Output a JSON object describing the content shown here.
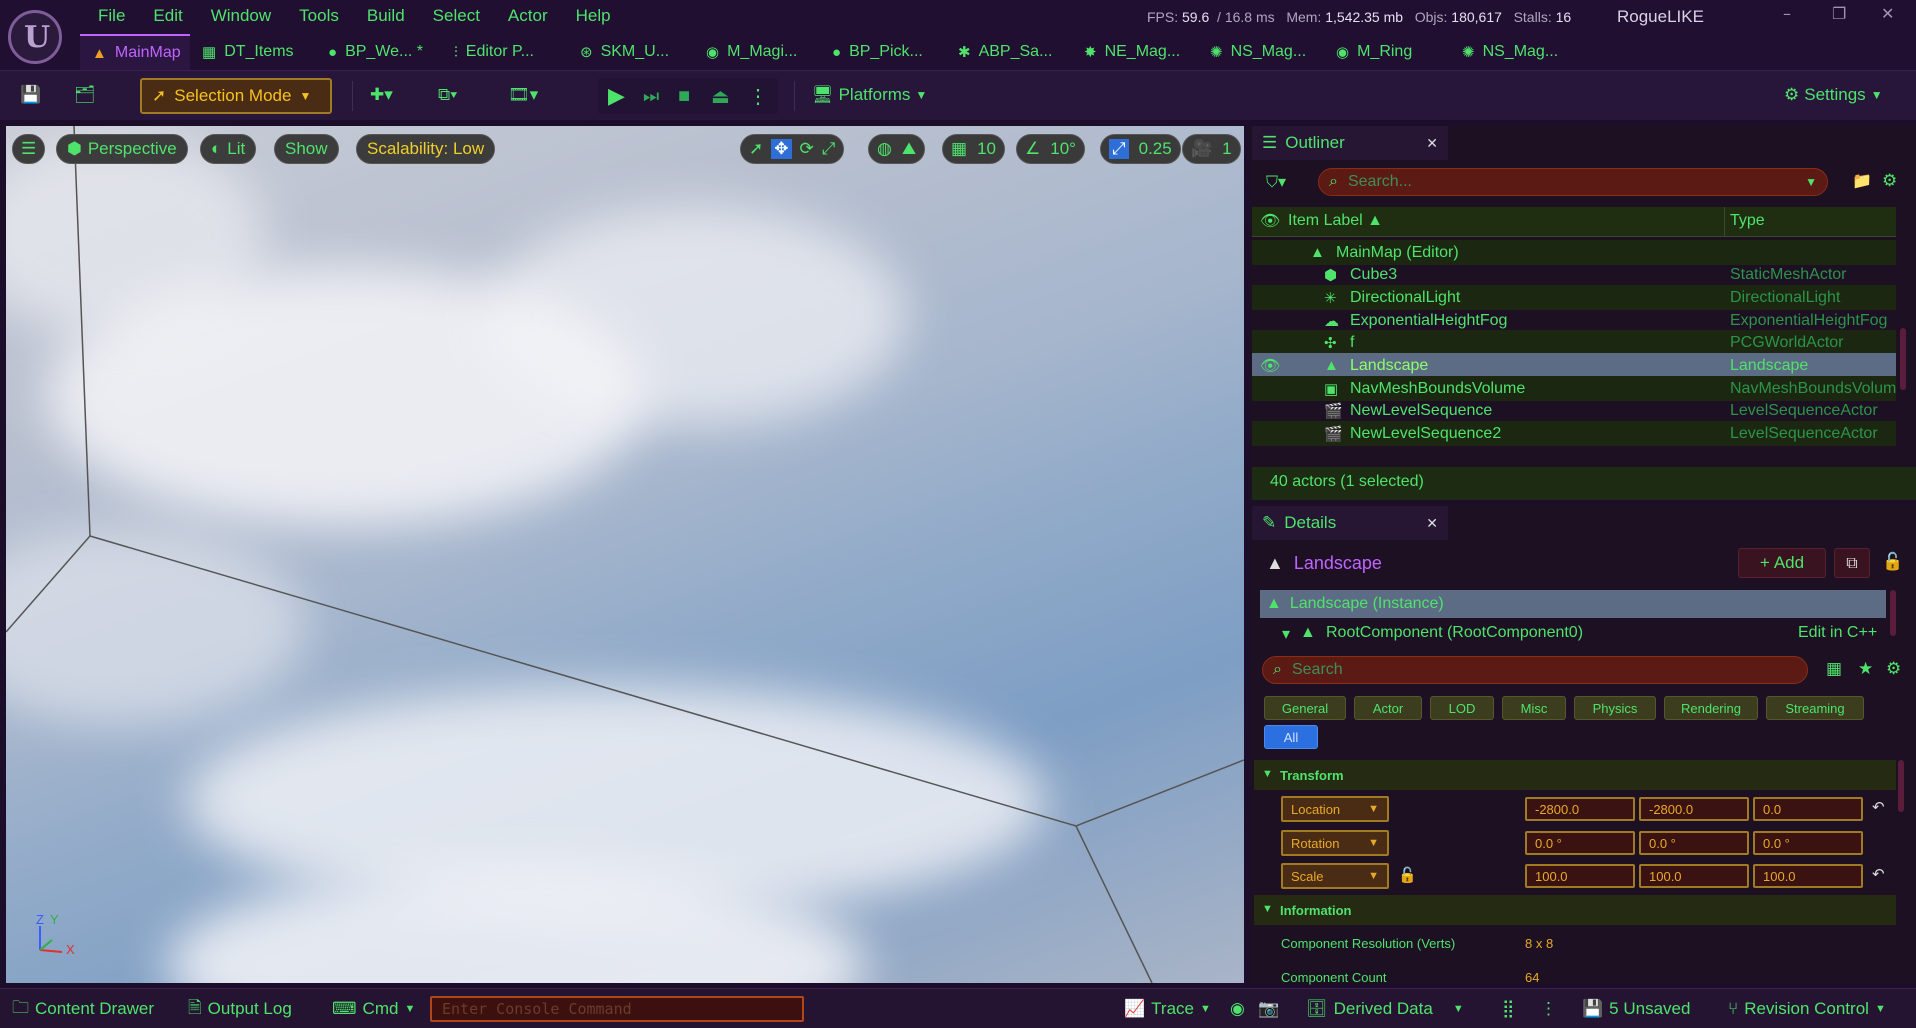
{
  "app": {
    "logo_letter": "U",
    "project_name": "RogueLIKE",
    "menu": [
      "File",
      "Edit",
      "Window",
      "Tools",
      "Build",
      "Select",
      "Actor",
      "Help"
    ],
    "stats": {
      "fps_label": "FPS:",
      "fps": "59.6",
      "ms": "/ 16.8 ms",
      "mem_label": "Mem:",
      "mem": "1,542.35 mb",
      "objs_label": "Objs:",
      "objs": "180,617",
      "stalls_label": "Stalls:",
      "stalls": "16"
    },
    "window_buttons": {
      "minimize": "–",
      "restore": "❐",
      "close": "✕"
    }
  },
  "tabs": [
    {
      "label": "MainMap",
      "icon": "level-icon",
      "glyph": "▲",
      "active": true
    },
    {
      "label": "DT_Items",
      "icon": "datatable-icon",
      "glyph": "▦"
    },
    {
      "label": "BP_We... *",
      "icon": "blueprint-icon",
      "glyph": "●"
    },
    {
      "label": "Editor P...",
      "icon": "settings-sliders-icon",
      "glyph": "⫶"
    },
    {
      "label": "SKM_U...",
      "icon": "skeletal-mesh-icon",
      "glyph": "⊛"
    },
    {
      "label": "M_Magi...",
      "icon": "material-icon",
      "glyph": "◉"
    },
    {
      "label": "BP_Pick...",
      "icon": "blueprint-icon",
      "glyph": "●"
    },
    {
      "label": "ABP_Sa...",
      "icon": "anim-blueprint-icon",
      "glyph": "✱"
    },
    {
      "label": "NE_Mag...",
      "icon": "niagara-emitter-icon",
      "glyph": "✸"
    },
    {
      "label": "NS_Mag...",
      "icon": "niagara-system-icon",
      "glyph": "✺"
    },
    {
      "label": "M_Ring",
      "icon": "material-icon",
      "glyph": "◉"
    },
    {
      "label": "NS_Mag...",
      "icon": "niagara-system-icon",
      "glyph": "✺"
    }
  ],
  "toolbar": {
    "selection_mode": "Selection Mode",
    "platforms": "Platforms",
    "settings": "Settings"
  },
  "viewport": {
    "menu_glyph": "☰",
    "perspective": "Perspective",
    "lit": "Lit",
    "show": "Show",
    "scalability": "Scalability: Low",
    "grid_snap": "10",
    "rotation_snap": "10°",
    "scale_snap": "0.25",
    "camera_speed": "1",
    "axis_z": "Z",
    "axis_y": "Y",
    "axis_x": "X"
  },
  "outliner": {
    "title": "Outliner",
    "search_placeholder": "Search...",
    "col_label": "Item Label ▲",
    "col_type": "Type",
    "rows": [
      {
        "label": "MainMap (Editor)",
        "type": "",
        "icon": "level-icon",
        "glyph": "▲",
        "indent": 0
      },
      {
        "label": "Cube3",
        "type": "StaticMeshActor",
        "icon": "static-mesh-icon",
        "glyph": "⬢",
        "indent": 1
      },
      {
        "label": "DirectionalLight",
        "type": "DirectionalLight",
        "icon": "directional-light-icon",
        "glyph": "✳",
        "indent": 1
      },
      {
        "label": "ExponentialHeightFog",
        "type": "ExponentialHeightFog",
        "icon": "fog-icon",
        "glyph": "☁",
        "indent": 1
      },
      {
        "label": "f",
        "type": "PCGWorldActor",
        "icon": "pcg-icon",
        "glyph": "✣",
        "indent": 1
      },
      {
        "label": "Landscape",
        "type": "Landscape",
        "icon": "landscape-icon",
        "glyph": "▲",
        "indent": 1,
        "selected": true
      },
      {
        "label": "NavMeshBoundsVolume",
        "type": "NavMeshBoundsVolume",
        "icon": "volume-icon",
        "glyph": "▣",
        "indent": 1
      },
      {
        "label": "NewLevelSequence",
        "type": "LevelSequenceActor",
        "icon": "sequence-icon",
        "glyph": "🎬",
        "indent": 1
      },
      {
        "label": "NewLevelSequence2",
        "type": "LevelSequenceActor",
        "icon": "sequence-icon",
        "glyph": "🎬",
        "indent": 1
      }
    ],
    "actor_count": "40 actors (1 selected)"
  },
  "details": {
    "title": "Details",
    "object_name": "Landscape",
    "add_label": "Add",
    "instance": "Landscape (Instance)",
    "root_component": "RootComponent (RootComponent0)",
    "edit_cpp": "Edit in C++",
    "search_placeholder": "Search",
    "filters": [
      "General",
      "Actor",
      "LOD",
      "Misc",
      "Physics",
      "Rendering",
      "Streaming"
    ],
    "filter_all": "All",
    "transform_title": "Transform",
    "location_label": "Location",
    "location": [
      "-2800.0",
      "-2800.0",
      "0.0"
    ],
    "rotation_label": "Rotation",
    "rotation": [
      "0.0 °",
      "0.0 °",
      "0.0 °"
    ],
    "scale_label": "Scale",
    "scale": [
      "100.0",
      "100.0",
      "100.0"
    ],
    "information_title": "Information",
    "info": [
      {
        "label": "Component Resolution (Verts)",
        "value": "8 x 8"
      },
      {
        "label": "Component Count",
        "value": "64"
      }
    ]
  },
  "statusbar": {
    "content_drawer": "Content Drawer",
    "output_log": "Output Log",
    "cmd": "Cmd",
    "console_placeholder": "Enter Console Command",
    "trace": "Trace",
    "derived_data": "Derived Data",
    "unsaved": "5 Unsaved",
    "revision_control": "Revision Control"
  },
  "colors": {
    "accent_green": "#4ee36b",
    "accent_purple": "#c064ff",
    "accent_amber": "#e9a928"
  }
}
